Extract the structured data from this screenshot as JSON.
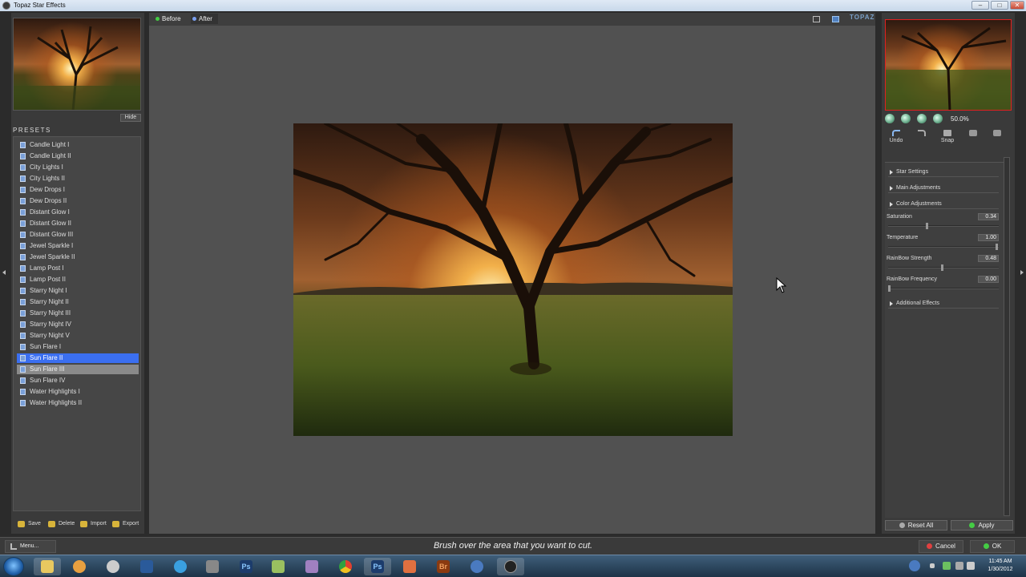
{
  "window": {
    "title": "Topaz Star Effects",
    "min": "–",
    "max": "□",
    "close": "✕"
  },
  "left": {
    "hide_label": "Hide",
    "presets_label": "PRESETS",
    "presets": [
      "Candle Light I",
      "Candle Light II",
      "City Lights I",
      "City Lights II",
      "Dew Drops I",
      "Dew Drops II",
      "Distant Glow I",
      "Distant Glow II",
      "Distant Glow III",
      "Jewel Sparkle I",
      "Jewel Sparkle II",
      "Lamp Post I",
      "Lamp Post II",
      "Starry Night I",
      "Starry Night II",
      "Starry Night III",
      "Starry Night IV",
      "Starry Night V",
      "Sun Flare I",
      "Sun Flare II",
      "Sun Flare III",
      "Sun Flare IV",
      "Water Highlights I",
      "Water Highlights II"
    ],
    "selected_preset": "Sun Flare II",
    "hover_preset": "Sun Flare III",
    "actions": {
      "save": "Save",
      "delete": "Delete",
      "import": "Import",
      "export": "Export"
    }
  },
  "center": {
    "tabs": {
      "before": "Before",
      "after": "After"
    },
    "brand": "TOPAZ"
  },
  "right": {
    "zoom_value": "50.0%",
    "tools": {
      "undo": "Undo",
      "redo": "",
      "snap": "Snap"
    },
    "sections": {
      "star_settings": "Star Settings",
      "main_adjustments": "Main Adjustments",
      "color_adjustments": "Color Adjustments",
      "additional_effects": "Additional Effects"
    },
    "params": [
      {
        "label": "Saturation",
        "value": "0.34"
      },
      {
        "label": "Temperature",
        "value": "1.00"
      },
      {
        "label": "RainBow Strength",
        "value": "0.48"
      },
      {
        "label": "RainBow Frequency",
        "value": "0.00"
      }
    ],
    "reset_label": "Reset All",
    "apply_label": "Apply"
  },
  "bottom": {
    "menu_label": "Menu...",
    "status": "Brush over the area that you want to cut.",
    "cancel_label": "Cancel",
    "ok_label": "OK"
  },
  "taskbar": {
    "time": "11:45 AM",
    "date": "1/30/2012",
    "app_ps1": "Ps",
    "app_ps2": "Ps",
    "app_br": "Br"
  },
  "colors": {
    "accent": "#3b6ff0",
    "panel": "#3a3a3a",
    "canvas": "#515151",
    "nav_border": "#e02020"
  }
}
